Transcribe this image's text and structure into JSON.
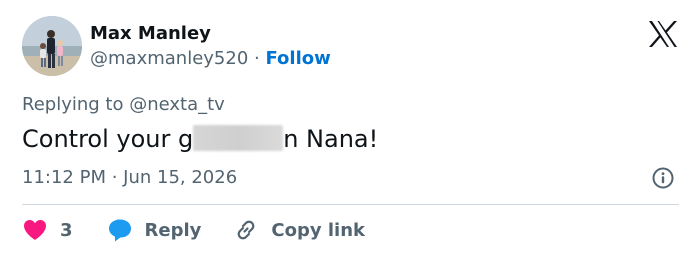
{
  "author": {
    "name": "Max Manley",
    "handle": "@maxmanley520",
    "separator": "·",
    "follow_label": "Follow"
  },
  "reply_context": {
    "prefix": "Replying to ",
    "mention": "@nexta_tv"
  },
  "tweet": {
    "text_before": "Control your g",
    "text_after": "n Nana!",
    "timestamp": "11:12 PM · Jun 15, 2026"
  },
  "actions": {
    "like_count": "3",
    "reply_label": "Reply",
    "copy_link_label": "Copy link"
  },
  "colors": {
    "like": "#f91880",
    "reply_icon": "#1d9bf0",
    "follow": "#0074d4",
    "secondary_text": "#536471"
  },
  "icons": {
    "brand": "x-logo-icon",
    "info": "info-icon",
    "like": "heart-icon",
    "reply": "speech-bubble-icon",
    "copy_link": "link-icon"
  }
}
